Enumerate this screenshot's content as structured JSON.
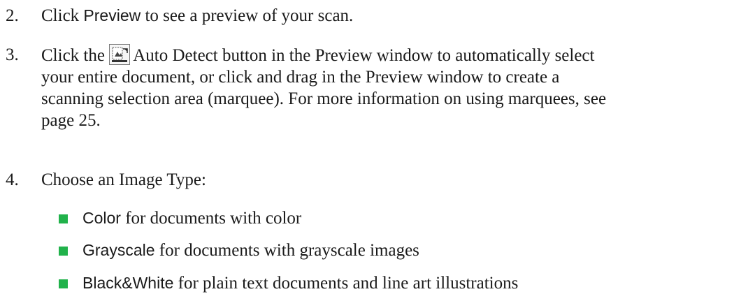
{
  "colors": {
    "text": "#1a1a1a",
    "bullet": "#21b24b"
  },
  "steps": [
    {
      "number": "2.",
      "ui_term": "Preview",
      "text_after": " to see a preview of your scan.",
      "text_before": "Click "
    },
    {
      "number": "3.",
      "text_before": "Click the ",
      "icon": "auto-detect-icon",
      "lines": [
        "Auto Detect button in the Preview window to automatically select",
        "your entire document, or click and drag in the Preview window to create a",
        "scanning selection area (marquee). For more information on using marquees, see",
        "page 25."
      ]
    },
    {
      "number": "4.",
      "text": "Choose an Image Type:",
      "bullets": [
        {
          "term": "Color",
          "desc": " for documents with color"
        },
        {
          "term": "Grayscale",
          "desc": " for documents with grayscale images"
        },
        {
          "term": "Black&White",
          "desc": " for plain text documents and line art illustrations"
        }
      ]
    }
  ]
}
